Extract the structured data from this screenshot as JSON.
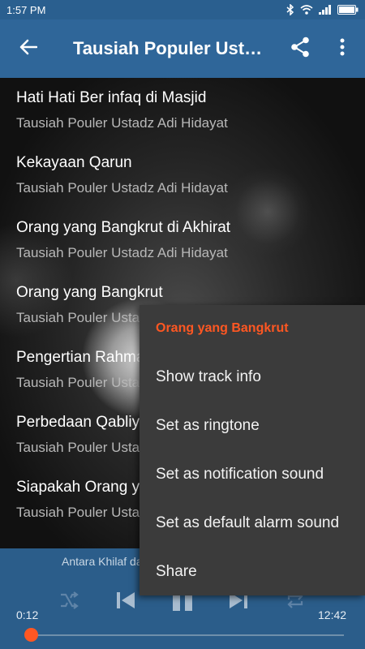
{
  "status_bar": {
    "time": "1:57 PM",
    "icons": [
      "bluetooth-icon",
      "wifi-icon",
      "signal-icon",
      "battery-icon"
    ]
  },
  "app_bar": {
    "title": "Tausiah Populer Ustadz Adi Hidayat",
    "back_icon": "arrow-left-icon",
    "share_icon": "share-icon",
    "more_icon": "more-vert-icon"
  },
  "tracks": [
    {
      "title": "Hati Hati Ber infaq di Masjid",
      "subtitle": "Tausiah Pouler Ustadz Adi Hidayat"
    },
    {
      "title": "Kekayaan Qarun",
      "subtitle": "Tausiah Pouler Ustadz Adi Hidayat"
    },
    {
      "title": "Orang yang Bangkrut di Akhirat",
      "subtitle": "Tausiah Pouler Ustadz Adi Hidayat"
    },
    {
      "title": "Orang yang Bangkrut",
      "subtitle": "Tausiah Pouler Ustadz Adi Hidayat"
    },
    {
      "title": "Pengertian Rahmat",
      "subtitle": "Tausiah Pouler Ustadz Adi Hidayat"
    },
    {
      "title": "Perbedaan Qabliyah",
      "subtitle": "Tausiah Pouler Ustadz Adi Hidayat"
    },
    {
      "title": "Siapakah Orang yang",
      "subtitle": "Tausiah Pouler Ustadz Adi Hidayat"
    }
  ],
  "player": {
    "now_playing": "Antara Khilaf dan",
    "elapsed": "0:12",
    "duration": "12:42",
    "progress": 0.016,
    "controls": [
      "shuffle-icon",
      "skip-previous-icon",
      "pause-icon",
      "skip-next-icon",
      "repeat-icon"
    ]
  },
  "context_menu": {
    "title": "Orang yang Bangkrut",
    "items": [
      "Show track info",
      "Set as ringtone",
      "Set as notification sound",
      "Set as default alarm sound",
      "Share"
    ]
  },
  "colors": {
    "app_bar": "#2f6699",
    "status_bar": "#2a5f8f",
    "accent": "#ff5722",
    "menu_bg": "#3b3b3b"
  }
}
